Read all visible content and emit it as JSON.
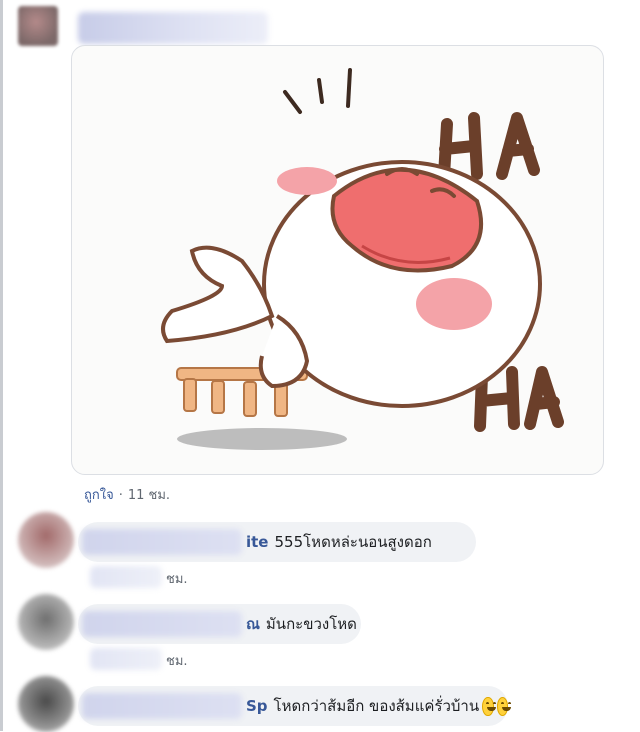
{
  "post": {
    "like_label": "ถูกใจ",
    "separator": "·",
    "time": "11 ชม.",
    "sticker": {
      "text_top": "HA",
      "colors": {
        "outline": "#6b3f2a",
        "mouth": "#ef6e6e",
        "blush": "#f4a3a8",
        "stool": "#e8a26d"
      }
    }
  },
  "comments": [
    {
      "name_visible_tail": "ite",
      "text": "555โหดหล่ะนอนสูงดอก",
      "time": "ชม."
    },
    {
      "name_visible_tail": "ณ",
      "text": "มันกะขวงโหด",
      "time": "ชม."
    },
    {
      "name_visible_tail": "Sp",
      "text": "โหดกว่าส้มอีก ของส้มแค่รั่วบ้าน",
      "emoji": [
        "grinning-face",
        "grinning-face"
      ]
    }
  ],
  "colors": {
    "link_blue": "#385898",
    "bubble_bg": "#f0f2f5",
    "meta_gray": "#606770"
  }
}
